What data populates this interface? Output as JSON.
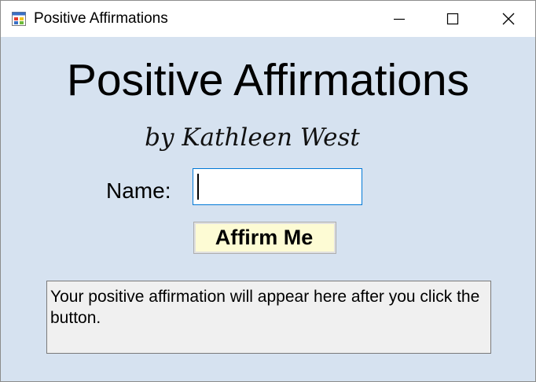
{
  "window": {
    "title": "Positive Affirmations",
    "background_color": "#d6e2f0",
    "icons": {
      "app": "app-window-icon",
      "minimize": "minimize-icon",
      "maximize": "maximize-icon",
      "close": "close-icon"
    }
  },
  "header": {
    "title": "Positive Affirmations",
    "byline": "by Kathleen West"
  },
  "form": {
    "name_label": "Name:",
    "name_value": "",
    "button_label": "Affirm Me",
    "button_color": "#fdfbd4"
  },
  "output": {
    "text": "Your positive affirmation will appear here after you click the button."
  }
}
